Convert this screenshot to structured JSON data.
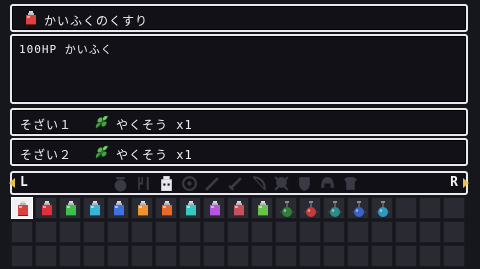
{
  "item": {
    "name": "かいふくのくすり",
    "icon": "red-potion-icon",
    "description": "100HP かいふく"
  },
  "materials": [
    {
      "label": "そざい１",
      "icon": "herb-icon",
      "name": "やくそう x1"
    },
    {
      "label": "そざい２",
      "icon": "herb-icon",
      "name": "やくそう x1"
    }
  ],
  "category_bar": {
    "left_key": "L",
    "right_key": "R",
    "categories": [
      "pot-icon",
      "cutlery-icon",
      "jar-icon",
      "ring-icon",
      "wand-icon",
      "sword-icon",
      "bow-icon",
      "skull-icon",
      "shield-icon",
      "helmet-icon",
      "armor-icon"
    ],
    "selected_index": 2
  },
  "inventory": {
    "columns": 19,
    "rows": 3,
    "selected_index": 0,
    "items": [
      {
        "icon": "red-potion-icon",
        "color": "#d8433f"
      },
      {
        "icon": "red-potion-icon",
        "color": "#e0303a"
      },
      {
        "icon": "green-potion-icon",
        "color": "#3fbf4a"
      },
      {
        "icon": "cyan-potion-icon",
        "color": "#35b6d8"
      },
      {
        "icon": "blue-potion-icon",
        "color": "#3b73e0"
      },
      {
        "icon": "orange-potion-icon",
        "color": "#f0922e"
      },
      {
        "icon": "orange-potion-icon",
        "color": "#e86a2a"
      },
      {
        "icon": "teal-potion-icon",
        "color": "#36c9c0"
      },
      {
        "icon": "purple-potion-icon",
        "color": "#b656e0"
      },
      {
        "icon": "red-potion-icon",
        "color": "#c8505a"
      },
      {
        "icon": "green-potion-icon",
        "color": "#65c24b"
      },
      {
        "icon": "round-flask-icon",
        "color": "#2f7f3a"
      },
      {
        "icon": "round-flask-icon",
        "color": "#c63a3a"
      },
      {
        "icon": "round-flask-icon",
        "color": "#2f8a8a"
      },
      {
        "icon": "round-flask-icon",
        "color": "#3a63c8"
      },
      {
        "icon": "round-flask-icon",
        "color": "#2f9abf"
      }
    ]
  },
  "colors": {
    "panel_border": "#e9e9ee",
    "panel_bg": "#111117",
    "slot_bg": "#2a2a33",
    "selected_slot": "#f1f1f4",
    "nav_arrow": "#e8c24a"
  }
}
